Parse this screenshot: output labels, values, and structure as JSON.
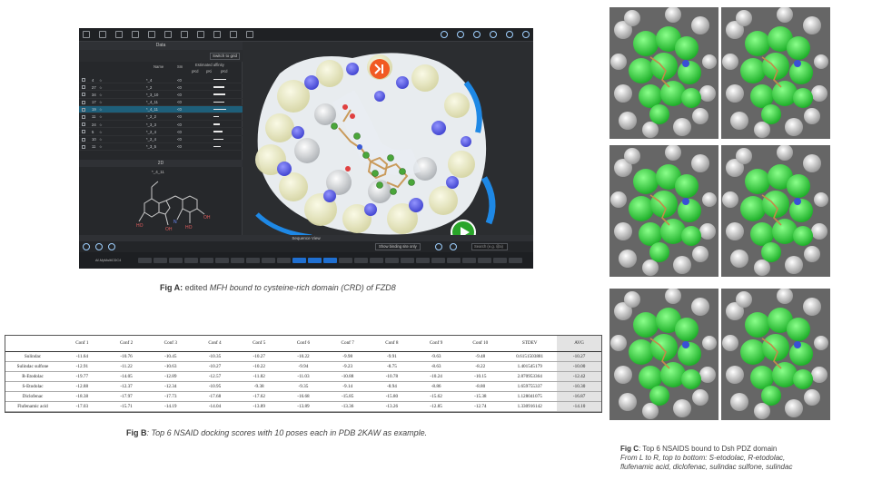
{
  "figA": {
    "panel_data_title": "Data",
    "switch_grid_label": "Switch to grid",
    "columns": {
      "name": "Name",
      "sm": "Sm",
      "affinity": "Estimated affinity",
      "units": [
        "pKd",
        "pKi",
        "pKd"
      ]
    },
    "rows": [
      {
        "n": "4",
        "name": "*_4",
        "sm": "<0"
      },
      {
        "n": "27",
        "name": "*_2",
        "sm": "<0"
      },
      {
        "n": "34",
        "name": "*_3_10",
        "sm": "<0"
      },
      {
        "n": "17",
        "name": "*_4_11",
        "sm": "<0"
      },
      {
        "n": "19",
        "name": "*_4_11",
        "sm": "<0",
        "selected": true
      },
      {
        "n": "11",
        "name": "*_2_2",
        "sm": "<0"
      },
      {
        "n": "24",
        "name": "*_3_3",
        "sm": "<0"
      },
      {
        "n": "5",
        "name": "*_2_4",
        "sm": "<0"
      },
      {
        "n": "10",
        "name": "*_2_4",
        "sm": "<0"
      },
      {
        "n": "11",
        "name": "*_3_5",
        "sm": "<0"
      }
    ],
    "panel_2d_title": "2D",
    "molecule_label": "*_4_11",
    "sequence_title": "Sequence View",
    "show_binding_label": "Show binding site only",
    "residue_placeholder": "Search (e.g. @a)",
    "sequence_label": "Af-MyMultiCDC4"
  },
  "captionA": {
    "label": "Fig A:",
    "text": " edited ",
    "italic": "MFH bound to cysteine-rich domain (CRD) of FZD8"
  },
  "table": {
    "headers": [
      "",
      "Conf 1",
      "Conf 2",
      "Conf 3",
      "Conf 4",
      "Conf 5",
      "Conf 6",
      "Conf 7",
      "Conf 8",
      "Conf 9",
      "Conf 10",
      "STDEV",
      "AVG"
    ],
    "rows": [
      [
        "Sulindac",
        "-11.64",
        "-10.76",
        "-10.45",
        "-10.35",
        "-10.27",
        "-10.22",
        "-9.98",
        "-9.91",
        "-9.63",
        "-9.48",
        "0.6151503881",
        "-10.27"
      ],
      [
        "Sulindac sulfone",
        "-12.91",
        "-11.22",
        "-10.63",
        "-10.27",
        "-10.22",
        "-9.94",
        "-9.23",
        "-8.75",
        "-8.63",
        "-8.22",
        "1.401545179",
        "-10.00"
      ],
      [
        "R-Etodolac",
        "-19.77",
        "-14.05",
        "-12.89",
        "-12.57",
        "-11.82",
        "-11.03",
        "-10.88",
        "-10.78",
        "-10.24",
        "-10.15",
        "2.870953364",
        "-12.42"
      ],
      [
        "S-Etodolac",
        "-12.88",
        "-12.37",
        "-12.34",
        "-10.95",
        "-9.38",
        "-9.35",
        "-9.14",
        "-8.94",
        "-8.86",
        "-8.80",
        "1.659755337",
        "-10.30"
      ],
      [
        "Diclofenac",
        "-18.38",
        "-17.97",
        "-17.73",
        "-17.68",
        "-17.62",
        "-16.68",
        "-15.85",
        "-15.80",
        "-15.62",
        "-15.38",
        "1.128041075",
        "-16.87"
      ],
      [
        "Flufenamic acid",
        "-17.03",
        "-15.71",
        "-14.19",
        "-14.04",
        "-13.89",
        "-13.89",
        "-13.36",
        "-13.26",
        "-12.85",
        "-12.74",
        "1.330916142",
        "-14.10"
      ]
    ]
  },
  "captionB": {
    "label": "Fig B",
    "text": ": Top 6 NSAID docking scores with 10 poses each in PDB 2KAW as example."
  },
  "captionC": {
    "label": "Fig C",
    "text": ": Top 6 NSAIDS bound to Dsh PDZ domain",
    "line2": "From L to R, top to bottom: S-etodolac, R-etodolac,",
    "line3": "flufenamic acid, diclofenac, sulindac sulfone, sulindac"
  },
  "colors": {
    "viewer_bg": "#2b2d30",
    "selection": "#1e5f7a",
    "protein_surface_green": "#33d13a",
    "tile_bg": "#666666",
    "play_button": "#2aa52a",
    "logo_orange": "#f15a22"
  }
}
